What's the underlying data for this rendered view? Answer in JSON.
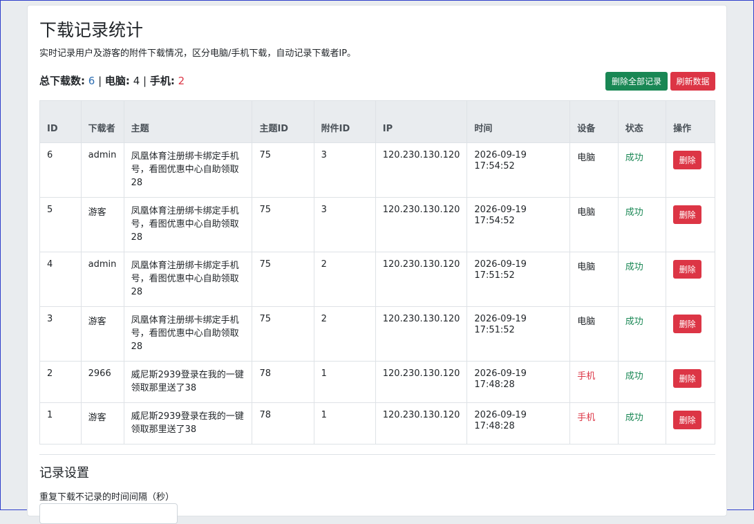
{
  "page": {
    "title": "下载记录统计",
    "description": "实时记录用户及游客的附件下载情况，区分电脑/手机下载，自动记录下载者IP。"
  },
  "stats": {
    "total_label": "总下载数:",
    "total_value": "6",
    "sep1": " | ",
    "pc_label": "电脑:",
    "pc_value": "4",
    "sep2": " | ",
    "mobile_label": "手机:",
    "mobile_value": "2"
  },
  "actions": {
    "delete_all": "删除全部记录",
    "refresh": "刷新数据"
  },
  "colors": {
    "green": "#198754",
    "red": "#dc3545",
    "blue": "#2b6cb0"
  },
  "table": {
    "headers": [
      "ID",
      "下载者",
      "主题",
      "主题ID",
      "附件ID",
      "IP",
      "时间",
      "设备",
      "状态",
      "操作"
    ],
    "rows": [
      {
        "id": "6",
        "user": "admin",
        "theme": "凤凰体育注册绑卡绑定手机号，看图优惠中心自助领取28",
        "theme_id": "75",
        "attach_id": "3",
        "ip": "120.230.130.120",
        "date": "2026-09-19",
        "clock": "17:54:52",
        "device": "电脑",
        "status": "成功",
        "action": "删除"
      },
      {
        "id": "5",
        "user": "游客",
        "theme": "凤凰体育注册绑卡绑定手机号，看图优惠中心自助领取28",
        "theme_id": "75",
        "attach_id": "3",
        "ip": "120.230.130.120",
        "date": "2026-09-19",
        "clock": "17:54:52",
        "device": "电脑",
        "status": "成功",
        "action": "删除"
      },
      {
        "id": "4",
        "user": "admin",
        "theme": "凤凰体育注册绑卡绑定手机号，看图优惠中心自助领取28",
        "theme_id": "75",
        "attach_id": "2",
        "ip": "120.230.130.120",
        "date": "2026-09-19",
        "clock": "17:51:52",
        "device": "电脑",
        "status": "成功",
        "action": "删除"
      },
      {
        "id": "3",
        "user": "游客",
        "theme": "凤凰体育注册绑卡绑定手机号，看图优惠中心自助领取28",
        "theme_id": "75",
        "attach_id": "2",
        "ip": "120.230.130.120",
        "date": "2026-09-19",
        "clock": "17:51:52",
        "device": "电脑",
        "status": "成功",
        "action": "删除"
      },
      {
        "id": "2",
        "user": "2966",
        "theme": "威尼斯2939登录在我的一键领取那里送了38",
        "theme_id": "78",
        "attach_id": "1",
        "ip": "120.230.130.120",
        "date": "2026-09-19",
        "clock": "17:48:28",
        "device": "手机",
        "status": "成功",
        "action": "删除"
      },
      {
        "id": "1",
        "user": "游客",
        "theme": "威尼斯2939登录在我的一键领取那里送了38",
        "theme_id": "78",
        "attach_id": "1",
        "ip": "120.230.130.120",
        "date": "2026-09-19",
        "clock": "17:48:28",
        "device": "手机",
        "status": "成功",
        "action": "删除"
      }
    ]
  },
  "settings": {
    "title": "记录设置",
    "interval_label": "重复下载不记录的时间间隔（秒）",
    "interval_value": ""
  }
}
